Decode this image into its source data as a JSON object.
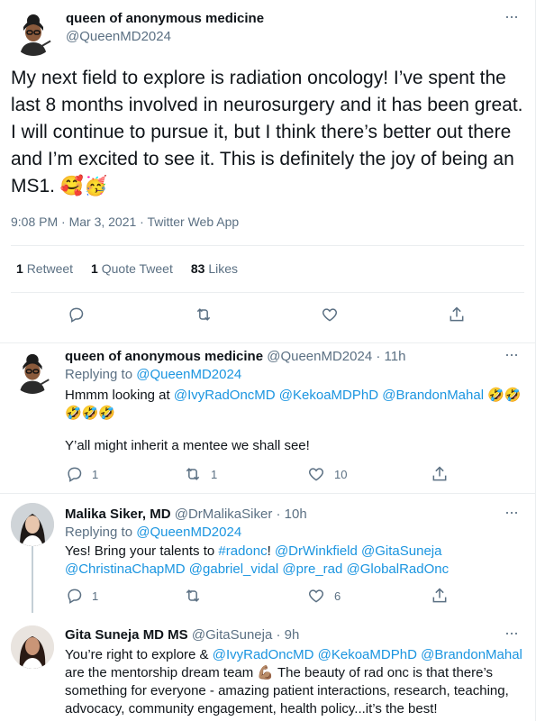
{
  "main_tweet": {
    "name": "queen of anonymous medicine",
    "handle": "@QueenMD2024",
    "text": "My next field to explore is radiation oncology! I’ve spent the last 8 months involved in neurosurgery and it has been great. I will continue to pursue it, but I think there’s better out there and I’m excited to see it. This is definitely the joy of being an MS1. 🥰🥳",
    "meta": "9:08 PM · Mar 3, 2021 · Twitter Web App",
    "stats": {
      "retweets_count": "1",
      "retweets_label": "Retweet",
      "quotes_count": "1",
      "quotes_label": "Quote Tweet",
      "likes_count": "83",
      "likes_label": "Likes"
    }
  },
  "replies": [
    {
      "name": "queen of anonymous medicine",
      "handle": "@QueenMD2024",
      "time": "11h",
      "replying_label": "Replying to",
      "replying_to": "@QueenMD2024",
      "text_prefix": "Hmmm looking at",
      "mentions": [
        "@IvyRadOncMD",
        "@KekoaMDPhD",
        "@BrandonMahal"
      ],
      "emoji_line1": "🤣🤣",
      "emoji_line2": "🤣🤣🤣",
      "text2": "Y’all might inherit a mentee we shall see!",
      "reply_count": "1",
      "retweet_count": "1",
      "like_count": "10"
    },
    {
      "name": "Malika Siker, MD",
      "handle": "@DrMalikaSiker",
      "time": "10h",
      "replying_label": "Replying to",
      "replying_to": "@QueenMD2024",
      "text_prefix": "Yes! Bring your talents to",
      "hashtag": "#radonc",
      "text_after": "!",
      "mentions_line1": [
        "@DrWinkfield",
        "@GitaSuneja"
      ],
      "mentions_line2": [
        "@ChristinaChapMD",
        "@gabriel_vidal",
        "@pre_rad",
        "@GlobalRadOnc"
      ],
      "reply_count": "1",
      "retweet_count": "",
      "like_count": "6"
    },
    {
      "name": "Gita Suneja MD MS",
      "handle": "@GitaSuneja",
      "time": "9h",
      "text_prefix": "You’re right to explore &",
      "mentions": [
        "@IvyRadOncMD",
        "@KekoaMDPhD",
        "@BrandonMahal"
      ],
      "text_line2": "are the mentorship dream team 💪🏽 The beauty of rad onc is that there’s",
      "text_line3": "something for everyone - amazing patient interactions, research, teaching,",
      "text_line4": "advocacy, community engagement, health policy...it’s the best!"
    }
  ],
  "colors": {
    "link": "#1b95e0",
    "muted": "#5b7083",
    "text": "#0f1419",
    "border": "#ebeef0"
  },
  "icons": [
    "reply-icon",
    "retweet-icon",
    "like-icon",
    "share-icon",
    "more-icon"
  ]
}
